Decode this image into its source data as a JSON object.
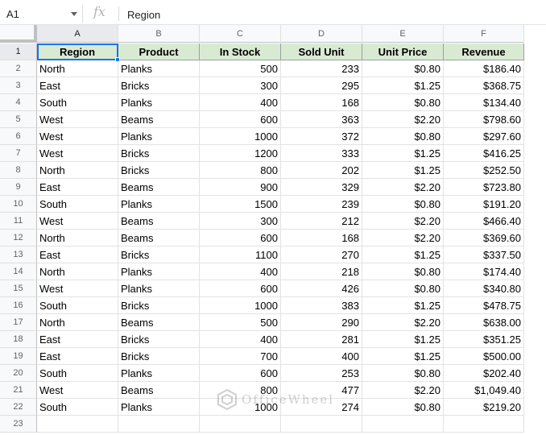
{
  "formula_bar": {
    "name_box": "A1",
    "fx_label": "fx",
    "formula": "Region"
  },
  "columns": [
    "A",
    "B",
    "C",
    "D",
    "E",
    "F"
  ],
  "header_row": [
    "Region",
    "Product",
    "In Stock",
    "Sold Unit",
    "Unit Price",
    "Revenue"
  ],
  "rows": [
    [
      "North",
      "Planks",
      "500",
      "233",
      "$0.80",
      "$186.40"
    ],
    [
      "East",
      "Bricks",
      "300",
      "295",
      "$1.25",
      "$368.75"
    ],
    [
      "South",
      "Planks",
      "400",
      "168",
      "$0.80",
      "$134.40"
    ],
    [
      "West",
      "Beams",
      "600",
      "363",
      "$2.20",
      "$798.60"
    ],
    [
      "West",
      "Planks",
      "1000",
      "372",
      "$0.80",
      "$297.60"
    ],
    [
      "West",
      "Bricks",
      "1200",
      "333",
      "$1.25",
      "$416.25"
    ],
    [
      "North",
      "Bricks",
      "800",
      "202",
      "$1.25",
      "$252.50"
    ],
    [
      "East",
      "Beams",
      "900",
      "329",
      "$2.20",
      "$723.80"
    ],
    [
      "South",
      "Planks",
      "1500",
      "239",
      "$0.80",
      "$191.20"
    ],
    [
      "West",
      "Beams",
      "300",
      "212",
      "$2.20",
      "$466.40"
    ],
    [
      "North",
      "Beams",
      "600",
      "168",
      "$2.20",
      "$369.60"
    ],
    [
      "East",
      "Bricks",
      "1100",
      "270",
      "$1.25",
      "$337.50"
    ],
    [
      "North",
      "Planks",
      "400",
      "218",
      "$0.80",
      "$174.40"
    ],
    [
      "West",
      "Planks",
      "600",
      "426",
      "$0.80",
      "$340.80"
    ],
    [
      "South",
      "Bricks",
      "1000",
      "383",
      "$1.25",
      "$478.75"
    ],
    [
      "North",
      "Beams",
      "500",
      "290",
      "$2.20",
      "$638.00"
    ],
    [
      "East",
      "Bricks",
      "400",
      "281",
      "$1.25",
      "$351.25"
    ],
    [
      "East",
      "Bricks",
      "700",
      "400",
      "$1.25",
      "$500.00"
    ],
    [
      "South",
      "Planks",
      "600",
      "253",
      "$0.80",
      "$202.40"
    ],
    [
      "West",
      "Beams",
      "800",
      "477",
      "$2.20",
      "$1,049.40"
    ],
    [
      "South",
      "Planks",
      "1000",
      "274",
      "$0.80",
      "$219.20"
    ]
  ],
  "row_numbers": [
    "1",
    "2",
    "3",
    "4",
    "5",
    "6",
    "7",
    "8",
    "9",
    "10",
    "11",
    "12",
    "13",
    "14",
    "15",
    "16",
    "17",
    "18",
    "19",
    "20",
    "21",
    "22",
    "23"
  ],
  "watermark": "OfficeWheel",
  "colors": {
    "header_fill": "#d9ead3",
    "selection": "#1a73e8"
  }
}
